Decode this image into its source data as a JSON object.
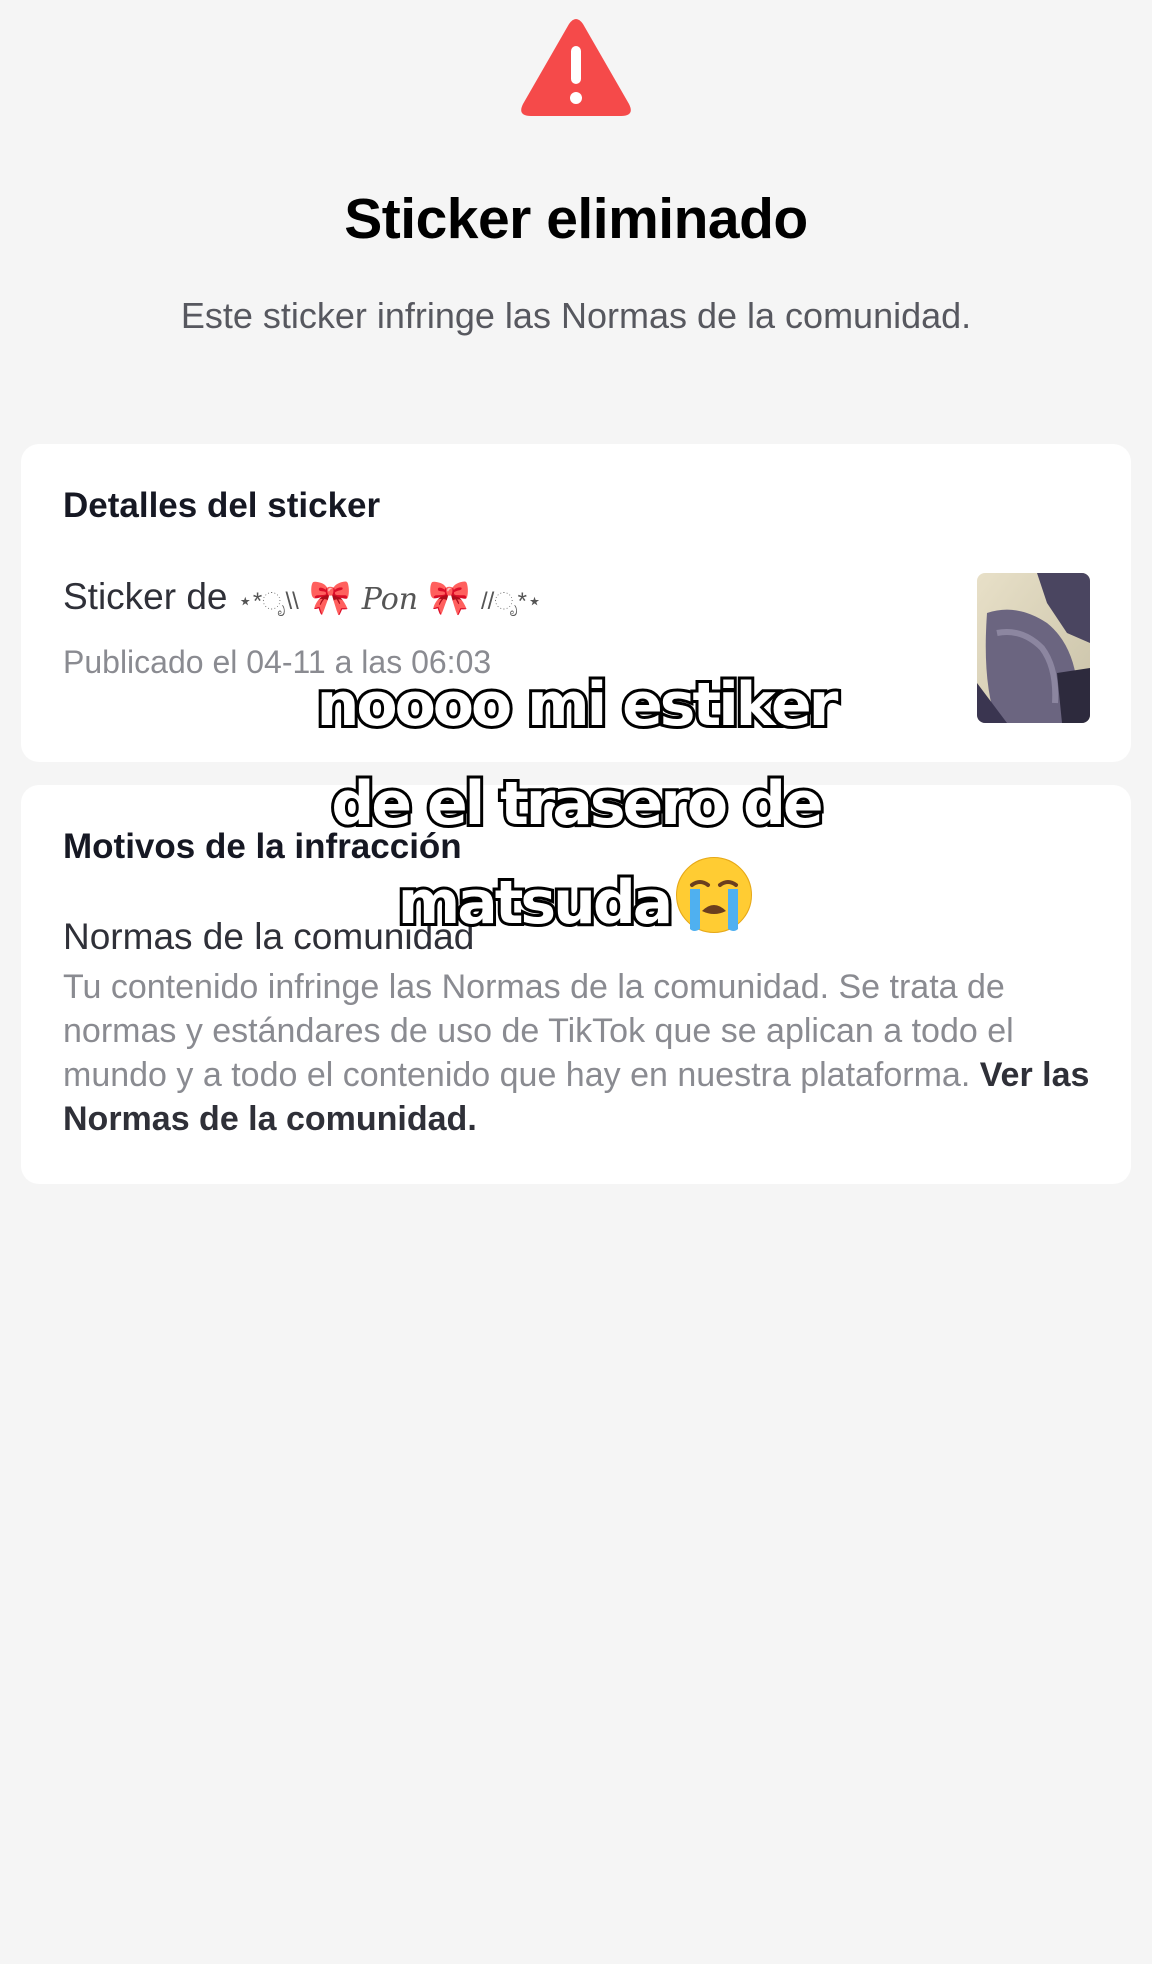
{
  "header": {
    "title": "Sticker eliminado",
    "subtitle": "Este sticker infringe las Normas de la comunidad."
  },
  "sticker_details": {
    "heading": "Detalles del sticker",
    "author_prefix": "Sticker de",
    "author_name_left": "⋆*ೃ\\\\",
    "author_name_mid": "Pon",
    "author_name_right": "//ೃ*⋆",
    "author_bow": "🎀",
    "published": "Publicado el 04-11 a las 06:03"
  },
  "violation": {
    "heading": "Motivos de la infracción",
    "rule_title": "Normas de la comunidad",
    "description": "Tu contenido infringe las Normas de la comunidad. Se trata de normas y estándares de uso de TikTok que se aplican a todo el mundo y a todo el contenido que hay en nuestra plataforma.",
    "link_label": "Ver las Normas de la comunidad."
  },
  "overlay_caption": {
    "line1": "noooo mi estiker",
    "line2": "de el trasero de",
    "line3": "matsuda"
  },
  "colors": {
    "warning": "#f54a4a",
    "background": "#f5f5f5",
    "card": "#ffffff"
  },
  "icons": {
    "warning": "warning-triangle-icon",
    "crying": "loudly-crying-face-emoji"
  }
}
